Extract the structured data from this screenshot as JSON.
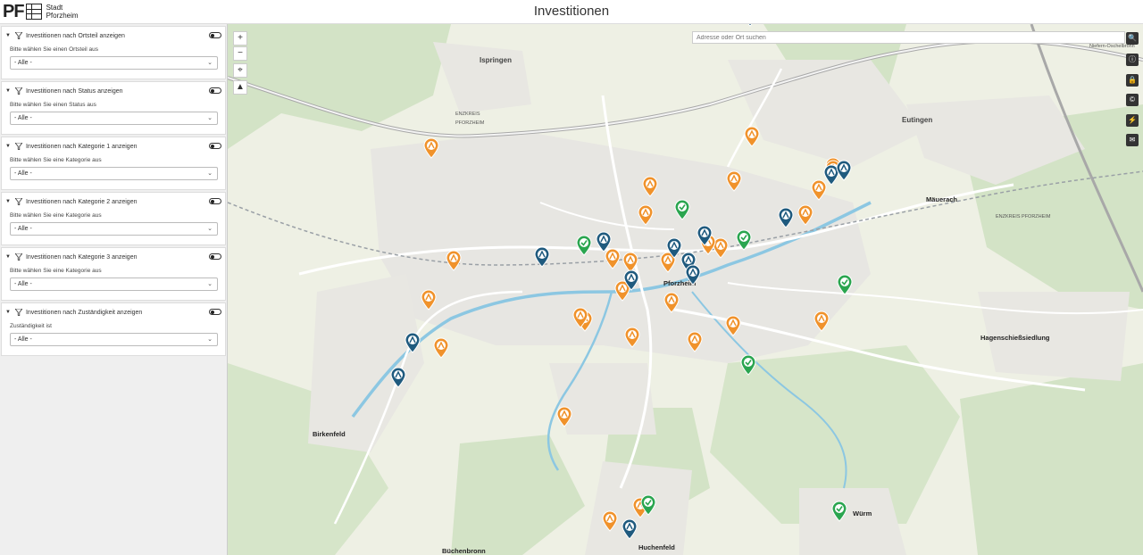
{
  "header": {
    "logo_mark": "PF",
    "logo_line1": "Stadt",
    "logo_line2": "Pforzheim",
    "title": "Investitionen"
  },
  "filters": [
    {
      "label": "Investitionen nach Ortsteil anzeigen",
      "hint": "Bitte wählen Sie einen Ortsteil aus",
      "value": "- Alle -"
    },
    {
      "label": "Investitionen nach Status anzeigen",
      "hint": "Bitte wählen Sie einen Status aus",
      "value": "- Alle -"
    },
    {
      "label": "Investitionen nach Kategorie 1 anzeigen",
      "hint": "Bitte wählen Sie eine Kategorie aus",
      "value": "- Alle -"
    },
    {
      "label": "Investitionen nach Kategorie 2 anzeigen",
      "hint": "Bitte wählen Sie eine Kategorie aus",
      "value": "- Alle -"
    },
    {
      "label": "Investitionen nach Kategorie 3 anzeigen",
      "hint": "Bitte wählen Sie eine Kategorie aus",
      "value": "- Alle -"
    },
    {
      "label": "Investitionen nach Zuständigkeit anzeigen",
      "hint": "Zuständigkeit ist",
      "value": "- Alle -"
    }
  ],
  "map": {
    "search_placeholder": "Adresse oder Ort suchen",
    "zoom_in": "+",
    "zoom_out": "−",
    "locate": "⌖",
    "compass": "▲",
    "side_buttons": [
      "🔍",
      "ⓘ",
      "🔒",
      "©",
      "⚡",
      "✉"
    ],
    "places": {
      "ispringen": "Ispringen",
      "eutingen": "Eutingen",
      "mauerach": "Mäuerach",
      "pforzheim": "Pforzheim",
      "hagenschiess": "Hagenschießsiedlung",
      "birkenfeld": "Birkenfeld",
      "wurm": "Würm",
      "huchenfeld": "Huchenfeld",
      "buchenbronn": "Büchenbronn",
      "niefern": "Niefern-Öschelbronn",
      "pforzheim_river": "PFORZHEIM",
      "enzkreis": "ENZKREIS",
      "enzkreis2": "ENZKREIS PFORZHEIM"
    },
    "colors": {
      "orange": "#f0922b",
      "blue": "#1f5a7e",
      "green": "#2aa54f",
      "river": "#7fc3e0",
      "road": "#ffffff",
      "forest": "#cfe1c4"
    }
  }
}
